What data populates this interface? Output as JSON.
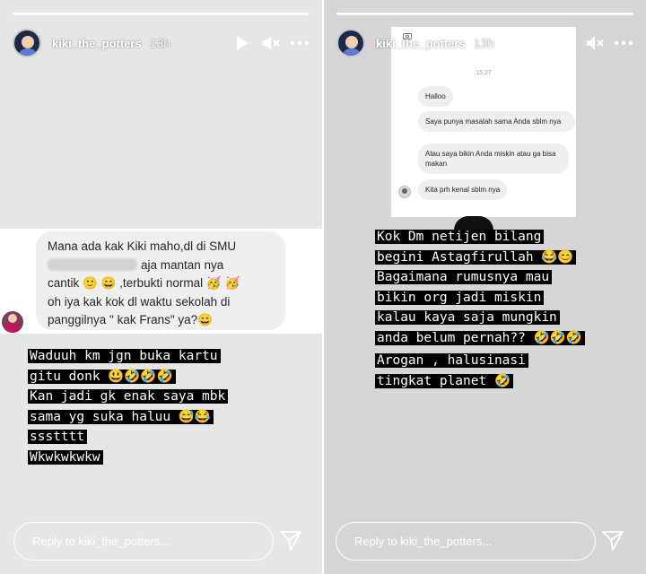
{
  "story_left": {
    "username": "kiki_the_potters",
    "time": "13h",
    "progress": 1.0,
    "comment_lines": [
      "Mana ada kak Kiki maho,dl di SMU",
      "aja mantan nya",
      "cantik 🙂 😄 ,terbukti normal 🥳 🥳",
      "oh iya kak kok dl waktu sekolah di",
      "panggilnya \" kak Frans\" ya?😄"
    ],
    "caption_lines": [
      "Waduuh km jgn buka kartu",
      "gitu donk 😃🤣🤣🤣",
      "Kan jadi gk enak saya mbk",
      "sama yg suka haluu 😅😂",
      "ssstttt",
      "Wkwkwkwkw"
    ],
    "reply_placeholder": "Reply to kiki_the_potters..."
  },
  "story_right": {
    "username": "kiki_the_potters",
    "time": "13h",
    "progress": 1.0,
    "dm_time": "15.27",
    "dm_messages": [
      "Halloo",
      "Saya punya masalah sama Anda sblm nya",
      "Atau saya bikin Anda miskin atau ga bisa makan",
      "Kita prh kenal sblm nya"
    ],
    "caption_lines": [
      "Kok Dm netijen bilang",
      "begini Astagfirullah 😂😊",
      "Bagaimana rumusnya mau",
      "bikin org jadi miskin",
      "kalau kaya saja mungkin",
      "anda belum pernah?? 🤣🤣🤣"
    ],
    "caption2_lines": [
      "Arogan , halusinasi",
      "tingkat planet 🤣"
    ],
    "reply_placeholder": "Reply to kiki_the_potters..."
  },
  "icons": {
    "play": "play-icon",
    "mute": "speaker-muted-icon",
    "more": "more-options-icon",
    "send": "send-icon"
  },
  "colors": {
    "caption_bg": "#000000",
    "caption_text": "#ffffff",
    "bubble_bg": "#efefef"
  }
}
